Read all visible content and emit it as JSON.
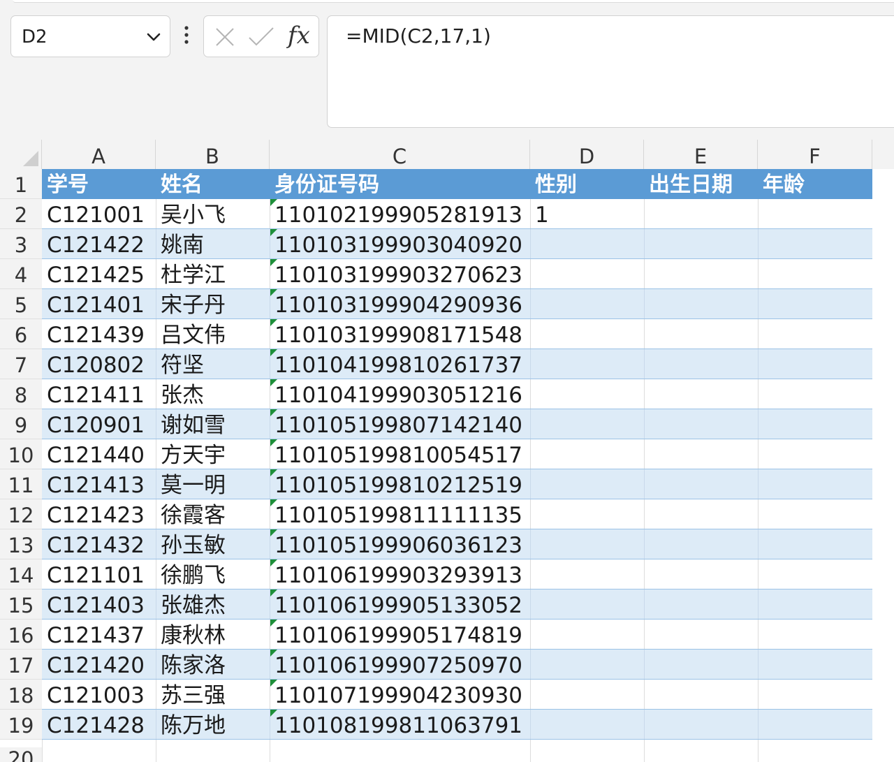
{
  "name_box": {
    "value": "D2"
  },
  "formula_bar": {
    "formula": "=MID(C2,17,1)",
    "fx_label": "fx"
  },
  "columns": [
    "A",
    "B",
    "C",
    "D",
    "E",
    "F"
  ],
  "row_numbers": [
    "1",
    "2",
    "3",
    "4",
    "5",
    "6",
    "7",
    "8",
    "9",
    "10",
    "11",
    "12",
    "13",
    "14",
    "15",
    "16",
    "17",
    "18",
    "19",
    "20"
  ],
  "table": {
    "headers": [
      "学号",
      "姓名",
      "身份证号码",
      "性别",
      "出生日期",
      "年龄"
    ],
    "rows": [
      [
        "C121001",
        "吴小飞",
        "110102199905281913",
        "1",
        "",
        ""
      ],
      [
        "C121422",
        "姚南",
        "110103199903040920",
        "",
        "",
        ""
      ],
      [
        "C121425",
        "杜学江",
        "110103199903270623",
        "",
        "",
        ""
      ],
      [
        "C121401",
        "宋子丹",
        "110103199904290936",
        "",
        "",
        ""
      ],
      [
        "C121439",
        "吕文伟",
        "110103199908171548",
        "",
        "",
        ""
      ],
      [
        "C120802",
        "符坚",
        "110104199810261737",
        "",
        "",
        ""
      ],
      [
        "C121411",
        "张杰",
        "110104199903051216",
        "",
        "",
        ""
      ],
      [
        "C120901",
        "谢如雪",
        "110105199807142140",
        "",
        "",
        ""
      ],
      [
        "C121440",
        "方天宇",
        "110105199810054517",
        "",
        "",
        ""
      ],
      [
        "C121413",
        "莫一明",
        "110105199810212519",
        "",
        "",
        ""
      ],
      [
        "C121423",
        "徐霞客",
        "110105199811111135",
        "",
        "",
        ""
      ],
      [
        "C121432",
        "孙玉敏",
        "110105199906036123",
        "",
        "",
        ""
      ],
      [
        "C121101",
        "徐鹏飞",
        "110106199903293913",
        "",
        "",
        ""
      ],
      [
        "C121403",
        "张雄杰",
        "110106199905133052",
        "",
        "",
        ""
      ],
      [
        "C121437",
        "康秋林",
        "110106199905174819",
        "",
        "",
        ""
      ],
      [
        "C121420",
        "陈家洛",
        "110106199907250970",
        "",
        "",
        ""
      ],
      [
        "C121003",
        "苏三强",
        "110107199904230930",
        "",
        "",
        ""
      ],
      [
        "C121428",
        "陈万地",
        "110108199811063791",
        "",
        "",
        ""
      ]
    ]
  },
  "colors": {
    "header_fill": "#5b9bd5",
    "band_fill": "#ddebf7",
    "text_marker": "#1e8f3a"
  },
  "icons": {
    "name_box_dropdown": "chevron-down-icon",
    "more_options": "vertical-dots-icon",
    "cancel": "close-icon",
    "enter": "checkmark-icon",
    "insert_function": "fx-icon",
    "select_all": "select-all-triangle-icon"
  }
}
